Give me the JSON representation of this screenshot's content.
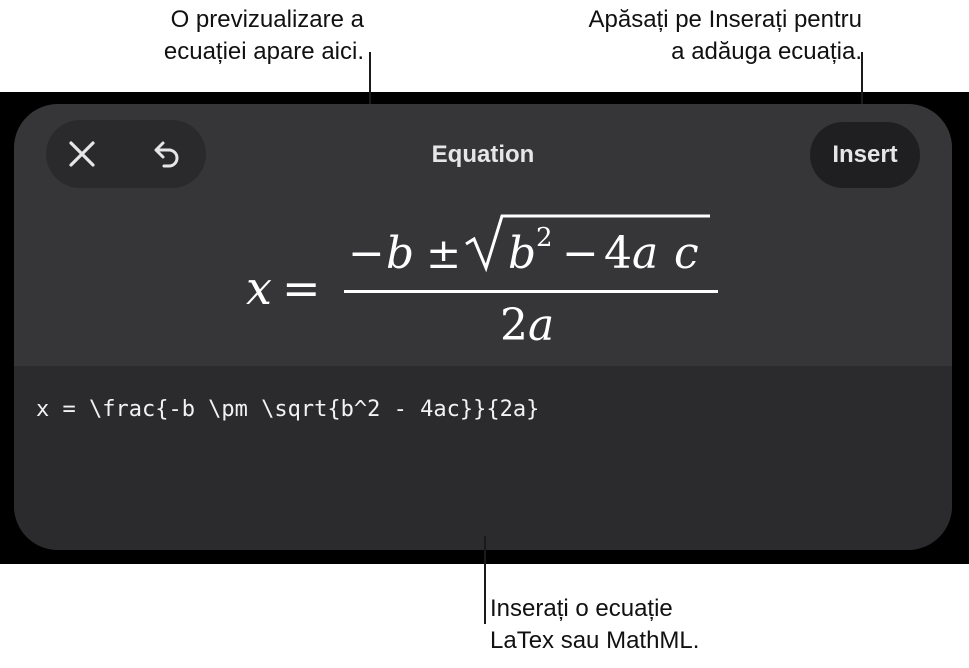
{
  "callouts": {
    "preview": {
      "line1": "O previzualizare a",
      "line2": "ecuației apare aici."
    },
    "insert": {
      "line1": "Apăsați pe Inserați pentru",
      "line2": "a adăuga ecuația."
    },
    "latex": {
      "line1": "Inserați o ecuație",
      "line2": "LaTex sau MathML."
    }
  },
  "dialog": {
    "title": "Equation",
    "insert_label": "Insert",
    "close_icon": "close-icon",
    "undo_icon": "undo-icon"
  },
  "preview": {
    "lhs": "x",
    "equals": "=",
    "numerator": {
      "minus": "−",
      "b": "b",
      "pm": "±",
      "radicand_base": "b",
      "exponent": "2",
      "minus2": "−",
      "coef": "4",
      "a": "a",
      "c": "c"
    },
    "denominator": {
      "coef": "2",
      "a": "a"
    }
  },
  "editor": {
    "source": "x = \\frac{-b \\pm \\sqrt{b^2 - 4ac}}{2a}"
  },
  "colors": {
    "band": "#000000",
    "panel": "#2b2b2d",
    "preview_bg": "#363638",
    "text": "#f2f2f4"
  }
}
